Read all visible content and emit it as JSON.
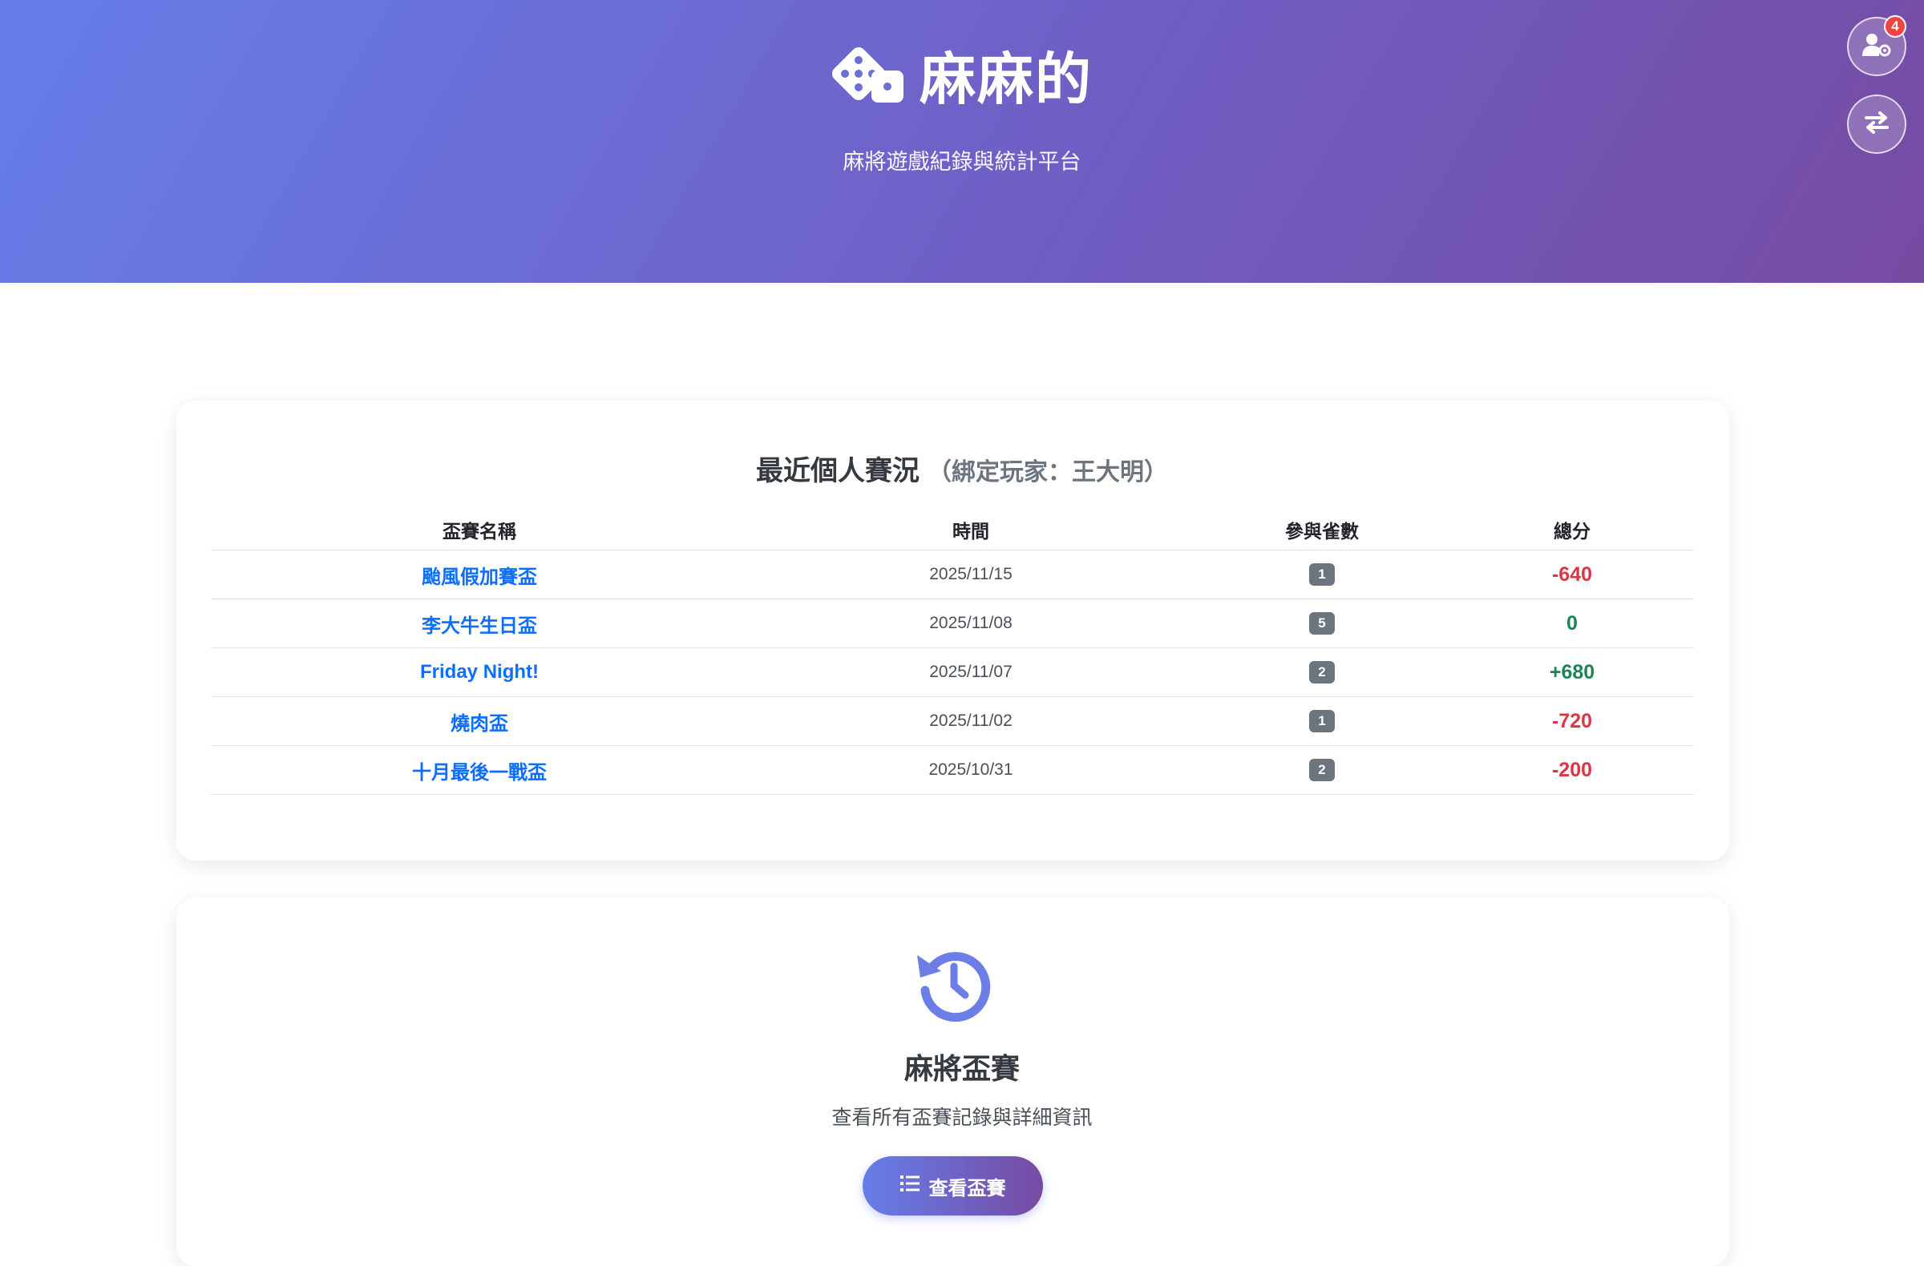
{
  "header": {
    "title": "麻麻的",
    "subtitle": "麻將遊戲紀錄與統計平台",
    "notification_count": "4"
  },
  "recent": {
    "title": "最近個人賽況",
    "bound_player": "（綁定玩家：王大明）",
    "columns": [
      "盃賽名稱",
      "時間",
      "參與雀數",
      "總分"
    ],
    "rows": [
      {
        "name": "颱風假加賽盃",
        "date": "2025/11/15",
        "rounds": "1",
        "score": "-640"
      },
      {
        "name": "李大牛生日盃",
        "date": "2025/11/08",
        "rounds": "5",
        "score": "0"
      },
      {
        "name": "Friday Night!",
        "date": "2025/11/07",
        "rounds": "2",
        "score": "+680"
      },
      {
        "name": "燒肉盃",
        "date": "2025/11/02",
        "rounds": "1",
        "score": "-720"
      },
      {
        "name": "十月最後一戰盃",
        "date": "2025/10/31",
        "rounds": "2",
        "score": "-200"
      }
    ]
  },
  "feature": {
    "title": "麻將盃賽",
    "description": "查看所有盃賽記錄與詳細資訊",
    "button_label": "查看盃賽"
  },
  "colors": {
    "gradient_start": "#667eea",
    "gradient_end": "#764ba2",
    "link": "#0d6efd",
    "negative": "#dc3545",
    "positive": "#198754"
  },
  "icons": {
    "brand": "dice-icon",
    "user_settings": "user-gear-icon",
    "switch": "exchange-arrows-icon",
    "history": "history-icon",
    "list": "list-icon"
  }
}
